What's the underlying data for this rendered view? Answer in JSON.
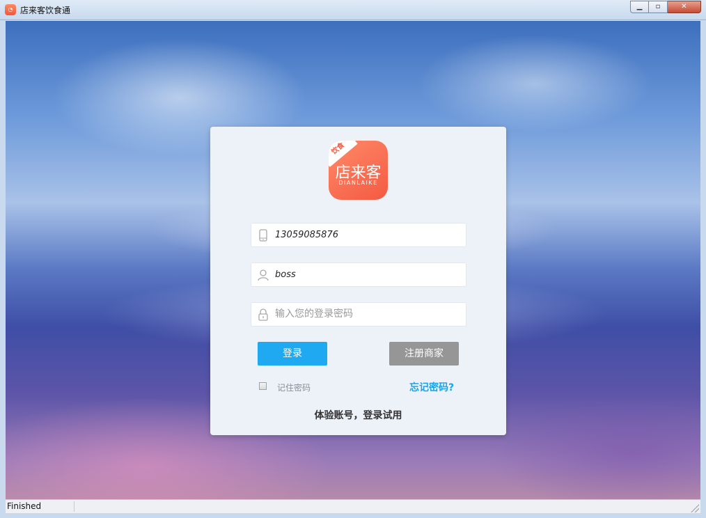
{
  "window": {
    "title": "店来客饮食通",
    "icon": "app-logo-icon",
    "controls": {
      "minimize": "minimize-icon",
      "maximize": "maximize-icon",
      "close": "close-icon"
    }
  },
  "logo": {
    "badge": "饮食",
    "main": "店来客",
    "sub": "DIANLAIKE"
  },
  "form": {
    "phone": {
      "value": "13059085876",
      "icon": "phone-icon"
    },
    "username": {
      "value": "boss",
      "icon": "user-icon"
    },
    "password": {
      "placeholder": "输入您的登录密码",
      "value": "",
      "icon": "lock-icon"
    },
    "login_label": "登录",
    "register_label": "注册商家",
    "remember_label": "记住密码",
    "forgot_label": "忘记密码?",
    "trial_label": "体验账号，登录试用"
  },
  "colors": {
    "accent": "#1fa9f1",
    "register": "#969696",
    "logo": "#f45a42",
    "link": "#1aa3e8"
  },
  "statusbar": {
    "text": "Finished"
  }
}
